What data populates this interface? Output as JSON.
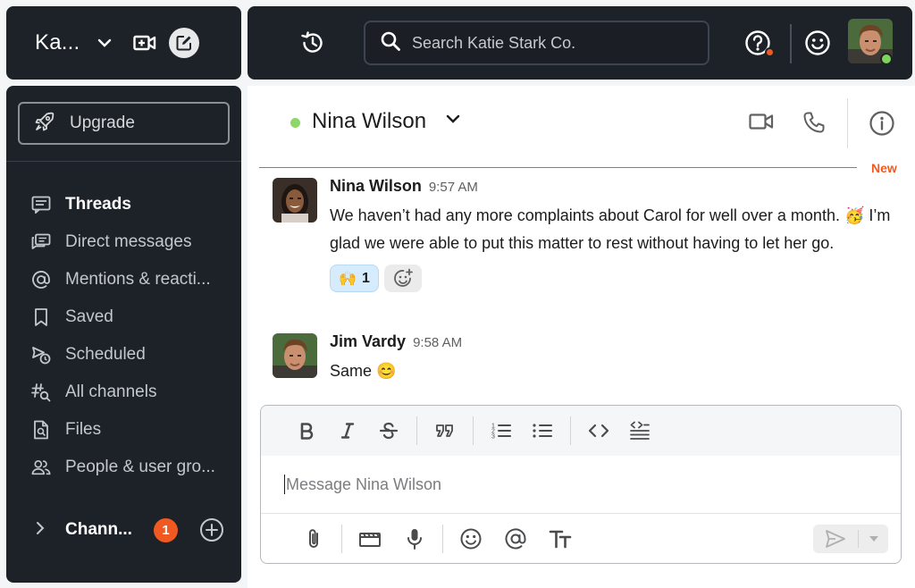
{
  "workspace": {
    "name": "Ka..."
  },
  "search": {
    "placeholder": "Search Katie Stark Co."
  },
  "sidebar": {
    "upgrade_label": "Upgrade",
    "items": [
      {
        "label": "Threads",
        "icon": "threads-icon",
        "active": true
      },
      {
        "label": "Direct messages",
        "icon": "direct-messages-icon"
      },
      {
        "label": "Mentions & reacti...",
        "icon": "at-icon"
      },
      {
        "label": "Saved",
        "icon": "bookmark-icon"
      },
      {
        "label": "Scheduled",
        "icon": "scheduled-send-icon"
      },
      {
        "label": "All channels",
        "icon": "channel-search-icon"
      },
      {
        "label": "Files",
        "icon": "file-search-icon"
      },
      {
        "label": "People & user gro...",
        "icon": "people-icon"
      }
    ],
    "channels": {
      "label": "Chann...",
      "badge": "1"
    }
  },
  "conversation": {
    "title": "Nina Wilson",
    "presence": "active",
    "new_label": "New"
  },
  "messages": [
    {
      "author": "Nina Wilson",
      "time": "9:57 AM",
      "text": "We haven’t had any more complaints about Carol for well over a month. 🥳 I’m glad we were able to put this matter to rest without having to let her go.",
      "reactions": [
        {
          "emoji": "🙌",
          "count": "1"
        }
      ]
    },
    {
      "author": "Jim Vardy",
      "time": "9:58 AM",
      "text": "Same 😊"
    }
  ],
  "composer": {
    "placeholder": "Message Nina Wilson"
  },
  "colors": {
    "dark_bg": "#1d2229",
    "accent_orange": "#f05a22",
    "presence_green": "#8dd66a",
    "reaction_bg": "#d6ebfb"
  }
}
